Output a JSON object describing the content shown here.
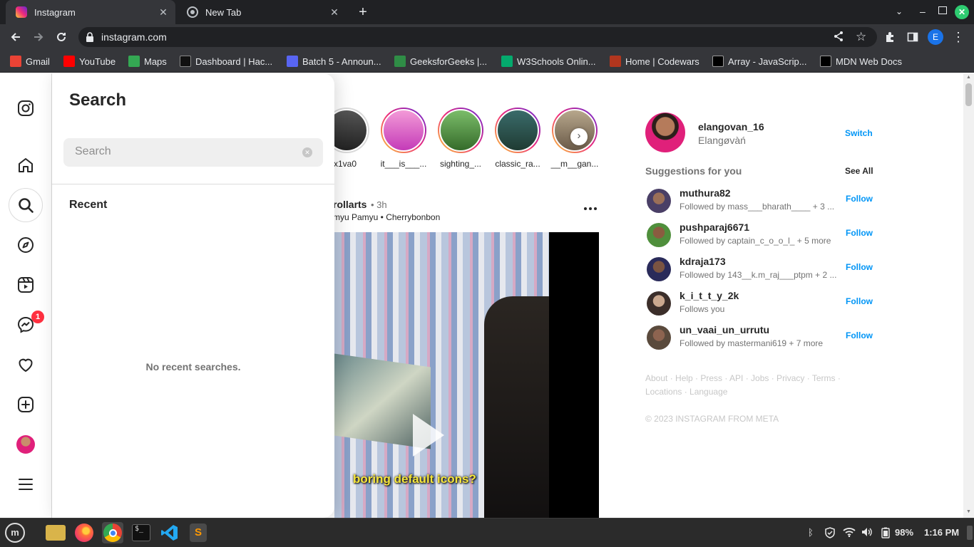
{
  "browser": {
    "tabs": [
      {
        "title": "Instagram",
        "active": true
      },
      {
        "title": "New Tab",
        "active": false
      }
    ],
    "url": "instagram.com",
    "profile_initial": "E",
    "bookmarks": [
      {
        "label": "Gmail",
        "color": "#ea4335"
      },
      {
        "label": "YouTube",
        "color": "#ff0000"
      },
      {
        "label": "Maps",
        "color": "#34a853"
      },
      {
        "label": "Dashboard | Hac...",
        "color": "#111111"
      },
      {
        "label": "Batch 5 - Announ...",
        "color": "#5865f2"
      },
      {
        "label": "GeeksforGeeks |...",
        "color": "#2f8d46"
      },
      {
        "label": "W3Schools Onlin...",
        "color": "#04aa6d"
      },
      {
        "label": "Home | Codewars",
        "color": "#b1361e"
      },
      {
        "label": "Array - JavaScrip...",
        "color": "#000000"
      },
      {
        "label": "MDN Web Docs",
        "color": "#000000"
      }
    ]
  },
  "nav": {
    "items": [
      "instagram-logo",
      "home",
      "search",
      "explore",
      "reels",
      "messages",
      "notifications",
      "create",
      "profile",
      "more"
    ],
    "messages_badge": "1"
  },
  "search_panel": {
    "title": "Search",
    "placeholder": "Search",
    "recent_label": "Recent",
    "empty_text": "No recent searches."
  },
  "stories": [
    {
      "name": "x1va0"
    },
    {
      "name": "it___is___..."
    },
    {
      "name": "sighting_..."
    },
    {
      "name": "classic_ra..."
    },
    {
      "name": "__m__gan..."
    }
  ],
  "post": {
    "username": "rollarts",
    "time": "• 3h",
    "audio": "myu Pamyu • Cherrybonbon",
    "caption": "boring default icons?"
  },
  "sidebar": {
    "username": "elangovan_16",
    "fullname": "Elangøvàń",
    "switch_label": "Switch",
    "suggestions_title": "Suggestions for you",
    "see_all": "See All",
    "suggestions": [
      {
        "username": "muthura82",
        "sub": "Followed by mass___bharath____ + 3 ...",
        "action": "Follow"
      },
      {
        "username": "pushparaj6671",
        "sub": "Followed by captain_c_o_o_l_ + 5 more",
        "action": "Follow"
      },
      {
        "username": "kdraja173",
        "sub": "Followed by 143__k.m_raj___ptpm + 2 ...",
        "action": "Follow"
      },
      {
        "username": "k_i_t_t_y_2k",
        "sub": "Follows you",
        "action": "Follow"
      },
      {
        "username": "un_vaai_un_urrutu",
        "sub": "Followed by mastermani619 + 7 more",
        "action": "Follow"
      }
    ],
    "footer_line1": "About · Help · Press · API · Jobs · Privacy · Terms ·",
    "footer_line2": "Locations · Language",
    "copyright": "© 2023 INSTAGRAM FROM META"
  },
  "taskbar": {
    "battery": "98%",
    "time": "1:16 PM"
  }
}
